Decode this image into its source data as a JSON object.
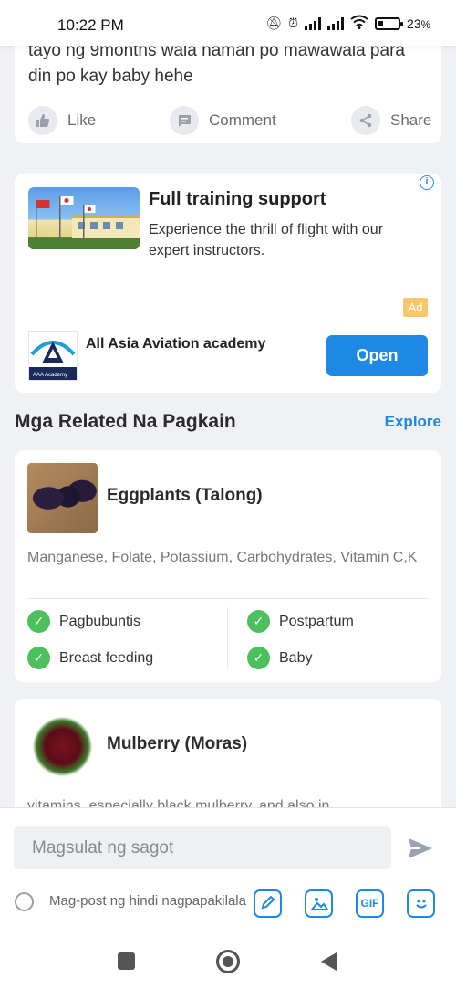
{
  "status_bar": {
    "time": "10:22 PM",
    "battery_text": "23"
  },
  "post": {
    "text": "tayo ng 9months wala naman po mawawala para din po kay baby hehe",
    "actions": [
      {
        "label": "Like",
        "icon": "thumbs-up-icon"
      },
      {
        "label": "Comment",
        "icon": "comment-icon"
      },
      {
        "label": "Share",
        "icon": "share-icon"
      }
    ]
  },
  "ad": {
    "title": "Full training support",
    "description": "Experience the thrill of flight with our expert instructors.",
    "badge": "Ad",
    "company": "All Asia Aviation academy",
    "button_label": "Open",
    "logo_caption": "AAA Academy"
  },
  "related": {
    "title": "Mga Related Na Pagkain",
    "explore_label": "Explore"
  },
  "foods": [
    {
      "name": "Eggplants (Talong)",
      "nutrients": "Manganese, Folate, Potassium, Carbohydrates, Vitamin C,K",
      "tags": [
        "Pagbubuntis",
        "Postpartum",
        "Breast feeding",
        "Baby"
      ]
    },
    {
      "name": "Mulberry (Moras)",
      "nutrients": "vitamins, especially black mulberry, and also in"
    }
  ],
  "reply": {
    "placeholder": "Magsulat ng sagot",
    "anonymous_label": "Mag-post ng hindi nagpapakilala",
    "tools": [
      "edit-icon",
      "image-icon",
      "gif-icon",
      "sticker-icon"
    ],
    "gif_label": "GIF"
  },
  "colors": {
    "accent": "#1e88e5",
    "check_green": "#4cc05c",
    "ad_badge": "#f7c86a"
  }
}
